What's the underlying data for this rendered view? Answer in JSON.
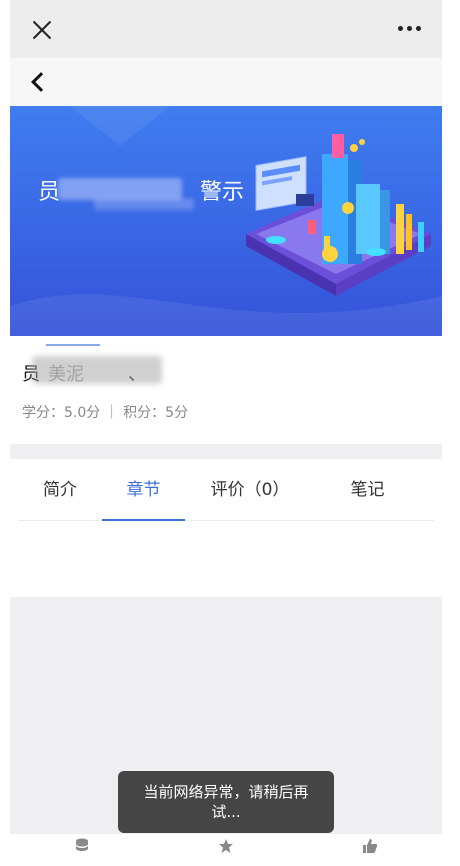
{
  "banner": {
    "title_start": "员",
    "title_end": "警示"
  },
  "course": {
    "name_start": "员",
    "name_mid": "美泥",
    "name_end": "、",
    "meta": "学分：5.0分 ｜ 积分：5分"
  },
  "tabs": [
    {
      "label": "简介",
      "active": false
    },
    {
      "label": "章节",
      "active": true
    },
    {
      "label": "评价（0）",
      "active": false
    },
    {
      "label": "笔记",
      "active": false
    }
  ],
  "toast": {
    "message": "当前网络异常，请稍后再试..."
  },
  "bottom_bar": {
    "icons": [
      "database-icon",
      "star-icon",
      "thumbs-up-icon"
    ]
  },
  "colors": {
    "accent": "#3b6fd9",
    "banner": "#3a66e5"
  }
}
